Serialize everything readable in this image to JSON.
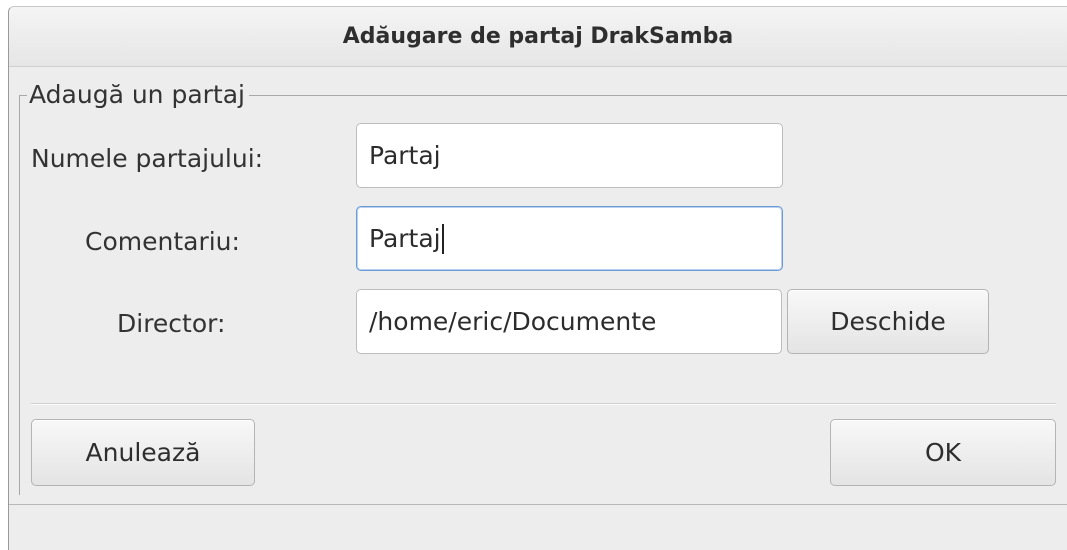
{
  "window": {
    "title": "Adăugare de partaj DrakSamba"
  },
  "group": {
    "legend": "Adaugă un partaj"
  },
  "form": {
    "share_name_label": "Numele partajului:",
    "share_name_value": "Partaj",
    "comment_label": "Comentariu:",
    "comment_value": "Partaj",
    "directory_label": "Director:",
    "directory_value": "/home/eric/Documente",
    "browse_label": "Deschide"
  },
  "actions": {
    "cancel_label": "Anulează",
    "ok_label": "OK"
  }
}
